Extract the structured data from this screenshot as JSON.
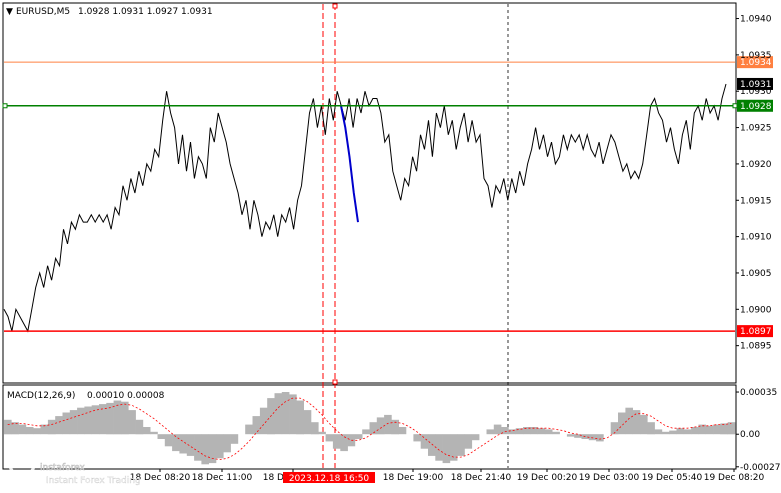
{
  "header": {
    "symbol": "EURUSD,M5",
    "ohlc": "1.0928 1.0931 1.0927 1.0931"
  },
  "macd": {
    "label": "MACD(12,26,9)",
    "values": "0.00010 0.00008",
    "axis_ticks": [
      "0.00035",
      "0.00",
      "-0.00027"
    ]
  },
  "watermark": {
    "brand": "instaforex",
    "tagline": "Instant Forex Trading"
  },
  "colors": {
    "price_line": "#000000",
    "green_level": "#008000",
    "red_level": "#ff0000",
    "orange_level": "#ff8040",
    "blue_segment": "#0000cc",
    "macd_hist": "#b4b4b4",
    "macd_signal": "#ff0000"
  },
  "chart_data": {
    "type": "line",
    "title": "EURUSD,M5",
    "ylim": [
      1.089,
      1.0942
    ],
    "y_ticks": [
      "1.0940",
      "1.0935",
      "1.0930",
      "1.0925",
      "1.0920",
      "1.0915",
      "1.0910",
      "1.0905",
      "1.0900",
      "1.0895"
    ],
    "x_ticks": [
      "18 Dec 08:20",
      "18 Dec 11:00",
      "18 Dec 13:40",
      "18 Dec 19:00",
      "18 Dec 21:40",
      "19 Dec 00:20",
      "19 Dec 03:00",
      "19 Dec 05:40",
      "19 Dec 08:20"
    ],
    "time_highlight": "2023.12.18 16:50",
    "levels": [
      {
        "label": "1.0934",
        "value": 1.0934,
        "color": "#ff8040"
      },
      {
        "label": "1.0931",
        "value": 1.0931,
        "color": "#000000"
      },
      {
        "label": "1.0928",
        "value": 1.0928,
        "color": "#008000"
      },
      {
        "label": "1.0897",
        "value": 1.0897,
        "color": "#ff0000"
      }
    ],
    "series": [
      {
        "values": [
          1.09,
          1.0899,
          1.0897,
          1.09,
          1.0899,
          1.0898,
          1.0897,
          1.09,
          1.0903,
          1.0905,
          1.0903,
          1.0906,
          1.0904,
          1.0907,
          1.0906,
          1.0911,
          1.0909,
          1.0912,
          1.0911,
          1.0913,
          1.0912,
          1.0912,
          1.0913,
          1.0912,
          1.0913,
          1.0912,
          1.0913,
          1.0911,
          1.0914,
          1.0913,
          1.0917,
          1.0915,
          1.0918,
          1.0916,
          1.0919,
          1.0917,
          1.092,
          1.0919,
          1.0922,
          1.0921,
          1.0926,
          1.093,
          1.0927,
          1.0925,
          1.092,
          1.0924,
          1.0919,
          1.0923,
          1.0918,
          1.0921,
          1.092,
          1.0918,
          1.0925,
          1.0923,
          1.0927,
          1.0925,
          1.0923,
          1.092,
          1.0918,
          1.0916,
          1.0913,
          1.0915,
          1.0911,
          1.0915,
          1.0913,
          1.091,
          1.0912,
          1.0911,
          1.0913,
          1.091,
          1.0913,
          1.0912,
          1.0914,
          1.0911,
          1.0915,
          1.0917,
          1.0922,
          1.0927,
          1.0929,
          1.0925,
          1.0928,
          1.0924,
          1.0929,
          1.0926,
          1.093,
          1.0928,
          1.0926,
          1.0929,
          1.0925,
          1.0929,
          1.0927,
          1.093,
          1.0928,
          1.0929
        ],
        "color": "#000000"
      },
      {
        "values": [
          1.0929,
          1.0927,
          1.0923,
          1.0924,
          1.0919,
          1.0917,
          1.0915,
          1.0918,
          1.0917,
          1.0921,
          1.0919,
          1.0924,
          1.0922,
          1.0926,
          1.0921,
          1.0927,
          1.0925,
          1.0928,
          1.0924,
          1.0926,
          1.0922,
          1.0925,
          1.0927,
          1.0923,
          1.0926,
          1.0923,
          1.0924,
          1.0918,
          1.0917,
          1.0914,
          1.0917,
          1.0916,
          1.0918,
          1.0915,
          1.0918,
          1.0916,
          1.0919,
          1.0917,
          1.092,
          1.0922,
          1.0925,
          1.0922,
          1.0924,
          1.0921,
          1.0923,
          1.092,
          1.0921,
          1.0924,
          1.0922,
          1.0924,
          1.0923,
          1.0924,
          1.0922,
          1.0924,
          1.0922,
          1.0921,
          1.0923,
          1.092,
          1.0922,
          1.0924,
          1.0923,
          1.0921,
          1.0919,
          1.092,
          1.0918,
          1.0919,
          1.0918,
          1.092,
          1.0924,
          1.0928,
          1.0929,
          1.0927,
          1.0926,
          1.0923,
          1.0925,
          1.0922,
          1.092,
          1.0924,
          1.0926,
          1.0922,
          1.0927,
          1.0928,
          1.0926,
          1.0929,
          1.0927,
          1.0928,
          1.0926,
          1.0929,
          1.0931
        ],
        "color": "#000000"
      },
      {
        "values": [
          1.0928,
          1.0925,
          1.0921,
          1.0916,
          1.0912
        ],
        "color": "#0000cc"
      }
    ],
    "macd_series": {
      "histogram": [
        0.00012,
        0.0001,
        8e-05,
        6e-05,
        5e-05,
        8e-05,
        0.00012,
        0.00015,
        0.00018,
        0.0002,
        0.00022,
        0.00023,
        0.00024,
        0.00025,
        0.00026,
        0.00028,
        0.00027,
        0.0002,
        0.00012,
        6e-05,
        2e-05,
        -4e-05,
        -0.0001,
        -0.00014,
        -0.00016,
        -0.00018,
        -0.00022,
        -0.00025,
        -0.00024,
        -0.0002,
        -0.00015,
        -8e-05,
        0.0,
        8e-05,
        0.00015,
        0.00022,
        0.0003,
        0.00034,
        0.00035,
        0.00033,
        0.00028,
        0.0002,
        0.0001,
        2e-05,
        -6e-05,
        -0.00012,
        -0.00014,
        -0.0001,
        -4e-05,
        4e-05,
        0.0001,
        0.00014,
        0.00016,
        0.00012,
        6e-05,
        0.0,
        -6e-05,
        -0.00012,
        -0.00018,
        -0.00022,
        -0.00024,
        -0.00022,
        -0.00018,
        -0.00012,
        -5e-05,
        0.0,
        4e-05,
        8e-05,
        6e-05,
        4e-05,
        5e-05,
        6e-05,
        6e-05,
        5e-05,
        4e-05,
        2e-05,
        0.0,
        -2e-05,
        -3e-05,
        -4e-05,
        -5e-05,
        -6e-05,
        0.0,
        0.0001,
        0.00018,
        0.00022,
        0.0002,
        0.00016,
        0.0001,
        4e-05,
        2e-05,
        3e-05,
        5e-05,
        4e-05,
        6e-05,
        8e-05,
        7e-05,
        8e-05,
        9e-05,
        0.0001
      ],
      "signal": [
        8e-05,
        9e-05,
        9e-05,
        8e-05,
        7e-05,
        7e-05,
        8e-05,
        0.0001,
        0.00012,
        0.00014,
        0.00016,
        0.00018,
        0.0002,
        0.00021,
        0.00022,
        0.00024,
        0.00025,
        0.00024,
        0.00021,
        0.00017,
        0.00013,
        8e-05,
        3e-05,
        -2e-05,
        -6e-05,
        -0.0001,
        -0.00014,
        -0.00018,
        -0.0002,
        -0.00021,
        -0.0002,
        -0.00017,
        -0.00012,
        -6e-05,
        1e-05,
        8e-05,
        0.00015,
        0.00022,
        0.00027,
        0.0003,
        0.0003,
        0.00027,
        0.00022,
        0.00016,
        9e-05,
        3e-05,
        -2e-05,
        -5e-05,
        -5e-05,
        -3e-05,
        1e-05,
        5e-05,
        9e-05,
        0.0001,
        9e-05,
        6e-05,
        2e-05,
        -3e-05,
        -8e-05,
        -0.00013,
        -0.00017,
        -0.00019,
        -0.00019,
        -0.00017,
        -0.00013,
        -9e-05,
        -5e-05,
        -1e-05,
        2e-05,
        3e-05,
        4e-05,
        5e-05,
        5e-05,
        5e-05,
        5e-05,
        4e-05,
        3e-05,
        1e-05,
        0.0,
        -2e-05,
        -3e-05,
        -4e-05,
        -3e-05,
        1e-05,
        7e-05,
        0.00013,
        0.00017,
        0.00017,
        0.00015,
        0.00011,
        7e-05,
        5e-05,
        5e-05,
        5e-05,
        6e-05,
        7e-05,
        7e-05,
        8e-05,
        8e-05,
        9e-05
      ],
      "ylim": [
        -0.00028,
        0.0004
      ]
    }
  }
}
